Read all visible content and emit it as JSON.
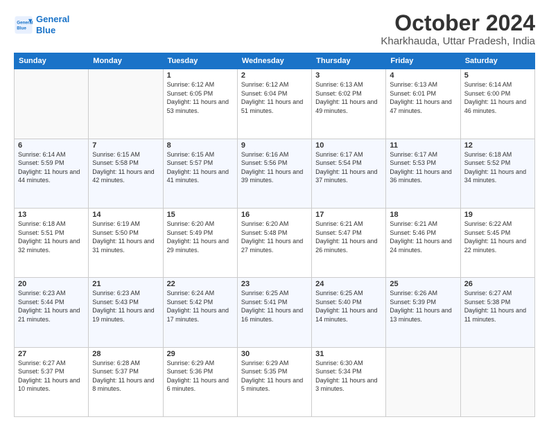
{
  "header": {
    "logo_line1": "General",
    "logo_line2": "Blue",
    "month": "October 2024",
    "location": "Kharkhauda, Uttar Pradesh, India"
  },
  "weekdays": [
    "Sunday",
    "Monday",
    "Tuesday",
    "Wednesday",
    "Thursday",
    "Friday",
    "Saturday"
  ],
  "weeks": [
    [
      {
        "day": "",
        "info": ""
      },
      {
        "day": "",
        "info": ""
      },
      {
        "day": "1",
        "info": "Sunrise: 6:12 AM\nSunset: 6:05 PM\nDaylight: 11 hours and 53 minutes."
      },
      {
        "day": "2",
        "info": "Sunrise: 6:12 AM\nSunset: 6:04 PM\nDaylight: 11 hours and 51 minutes."
      },
      {
        "day": "3",
        "info": "Sunrise: 6:13 AM\nSunset: 6:02 PM\nDaylight: 11 hours and 49 minutes."
      },
      {
        "day": "4",
        "info": "Sunrise: 6:13 AM\nSunset: 6:01 PM\nDaylight: 11 hours and 47 minutes."
      },
      {
        "day": "5",
        "info": "Sunrise: 6:14 AM\nSunset: 6:00 PM\nDaylight: 11 hours and 46 minutes."
      }
    ],
    [
      {
        "day": "6",
        "info": "Sunrise: 6:14 AM\nSunset: 5:59 PM\nDaylight: 11 hours and 44 minutes."
      },
      {
        "day": "7",
        "info": "Sunrise: 6:15 AM\nSunset: 5:58 PM\nDaylight: 11 hours and 42 minutes."
      },
      {
        "day": "8",
        "info": "Sunrise: 6:15 AM\nSunset: 5:57 PM\nDaylight: 11 hours and 41 minutes."
      },
      {
        "day": "9",
        "info": "Sunrise: 6:16 AM\nSunset: 5:56 PM\nDaylight: 11 hours and 39 minutes."
      },
      {
        "day": "10",
        "info": "Sunrise: 6:17 AM\nSunset: 5:54 PM\nDaylight: 11 hours and 37 minutes."
      },
      {
        "day": "11",
        "info": "Sunrise: 6:17 AM\nSunset: 5:53 PM\nDaylight: 11 hours and 36 minutes."
      },
      {
        "day": "12",
        "info": "Sunrise: 6:18 AM\nSunset: 5:52 PM\nDaylight: 11 hours and 34 minutes."
      }
    ],
    [
      {
        "day": "13",
        "info": "Sunrise: 6:18 AM\nSunset: 5:51 PM\nDaylight: 11 hours and 32 minutes."
      },
      {
        "day": "14",
        "info": "Sunrise: 6:19 AM\nSunset: 5:50 PM\nDaylight: 11 hours and 31 minutes."
      },
      {
        "day": "15",
        "info": "Sunrise: 6:20 AM\nSunset: 5:49 PM\nDaylight: 11 hours and 29 minutes."
      },
      {
        "day": "16",
        "info": "Sunrise: 6:20 AM\nSunset: 5:48 PM\nDaylight: 11 hours and 27 minutes."
      },
      {
        "day": "17",
        "info": "Sunrise: 6:21 AM\nSunset: 5:47 PM\nDaylight: 11 hours and 26 minutes."
      },
      {
        "day": "18",
        "info": "Sunrise: 6:21 AM\nSunset: 5:46 PM\nDaylight: 11 hours and 24 minutes."
      },
      {
        "day": "19",
        "info": "Sunrise: 6:22 AM\nSunset: 5:45 PM\nDaylight: 11 hours and 22 minutes."
      }
    ],
    [
      {
        "day": "20",
        "info": "Sunrise: 6:23 AM\nSunset: 5:44 PM\nDaylight: 11 hours and 21 minutes."
      },
      {
        "day": "21",
        "info": "Sunrise: 6:23 AM\nSunset: 5:43 PM\nDaylight: 11 hours and 19 minutes."
      },
      {
        "day": "22",
        "info": "Sunrise: 6:24 AM\nSunset: 5:42 PM\nDaylight: 11 hours and 17 minutes."
      },
      {
        "day": "23",
        "info": "Sunrise: 6:25 AM\nSunset: 5:41 PM\nDaylight: 11 hours and 16 minutes."
      },
      {
        "day": "24",
        "info": "Sunrise: 6:25 AM\nSunset: 5:40 PM\nDaylight: 11 hours and 14 minutes."
      },
      {
        "day": "25",
        "info": "Sunrise: 6:26 AM\nSunset: 5:39 PM\nDaylight: 11 hours and 13 minutes."
      },
      {
        "day": "26",
        "info": "Sunrise: 6:27 AM\nSunset: 5:38 PM\nDaylight: 11 hours and 11 minutes."
      }
    ],
    [
      {
        "day": "27",
        "info": "Sunrise: 6:27 AM\nSunset: 5:37 PM\nDaylight: 11 hours and 10 minutes."
      },
      {
        "day": "28",
        "info": "Sunrise: 6:28 AM\nSunset: 5:37 PM\nDaylight: 11 hours and 8 minutes."
      },
      {
        "day": "29",
        "info": "Sunrise: 6:29 AM\nSunset: 5:36 PM\nDaylight: 11 hours and 6 minutes."
      },
      {
        "day": "30",
        "info": "Sunrise: 6:29 AM\nSunset: 5:35 PM\nDaylight: 11 hours and 5 minutes."
      },
      {
        "day": "31",
        "info": "Sunrise: 6:30 AM\nSunset: 5:34 PM\nDaylight: 11 hours and 3 minutes."
      },
      {
        "day": "",
        "info": ""
      },
      {
        "day": "",
        "info": ""
      }
    ]
  ]
}
